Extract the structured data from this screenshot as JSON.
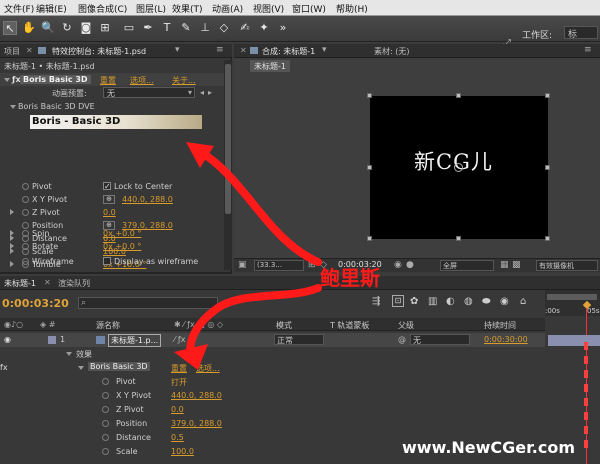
{
  "menu": [
    "文件(F)",
    "编辑(E)",
    "图像合成(C)",
    "图层(L)",
    "效果(T)",
    "动画(A)",
    "视图(V)",
    "窗口(W)",
    "帮助(H)"
  ],
  "toolbar": {
    "workspace_label": "工作区:",
    "workspace_value": "标"
  },
  "left_panel": {
    "tab_project": "项目",
    "tab_effect_controls": "特效控制台: 未标题-1.psd",
    "breadcrumb": "未标题-1 • 未标题-1.psd",
    "effect_name": "Boris Basic 3D",
    "reset": "重置",
    "options": "选项...",
    "about": "关于...",
    "preset_label": "动画预置:",
    "preset_value": "无",
    "group_name": "Boris Basic 3D DVE",
    "logo_text": "Boris - Basic 3D",
    "params": [
      {
        "name": "Pivot",
        "value": "Lock to Center",
        "kind": "checkbox"
      },
      {
        "name": "X Y Pivot",
        "value": "440.0, 288.0",
        "kind": "point"
      },
      {
        "name": "Z Pivot",
        "value": "0.0",
        "kind": "twirl"
      },
      {
        "name": "Position",
        "value": "379.0, 288.0",
        "kind": "point"
      },
      {
        "name": "Distance",
        "value": "0.0",
        "kind": "twirl"
      },
      {
        "name": "Scale",
        "value": "100.0",
        "kind": "plain"
      },
      {
        "name": "Tumble",
        "value": "0x +10.0 °",
        "kind": "plain"
      },
      {
        "name": "Spin",
        "value": "0x +0.0 °",
        "kind": "plain"
      },
      {
        "name": "Rotate",
        "value": "0x +0.0 °",
        "kind": "plain"
      },
      {
        "name": "Wireframe",
        "value": "Display as wireframe",
        "kind": "checkbox"
      }
    ]
  },
  "comp_panel": {
    "tab_comp": "合成: 未标题-1",
    "tab_footage": "素材: (无)",
    "sub_tab": "未标题-1",
    "canvas_text": "新CG儿",
    "zoom_value": "(33.3...",
    "timecode": "0:00:03:20",
    "quality": "全屏",
    "camera": "有效摄像机"
  },
  "timeline": {
    "tab_comp": "未标题-1",
    "tab_render": "渲染队列",
    "timecode": "0:00:03:20",
    "columns": {
      "name": "源名称",
      "mode": "模式",
      "trkmat": "T  轨道蒙板",
      "parent": "父级",
      "duration": "持续时间"
    },
    "layer_index": "1",
    "layer_name": "未标题-1.p...",
    "layer_mode": "正常",
    "layer_parent": "无",
    "layer_duration": "0:00:30:00",
    "effects_label": "效果",
    "effect_name": "Boris Basic 3D",
    "reset": "重置",
    "options": "选项...",
    "ruler_0": ":00s",
    "ruler_1": "05s",
    "rows": [
      {
        "name": "Pivot",
        "value": "打开"
      },
      {
        "name": "X Y Pivot",
        "value": "440.0, 288.0"
      },
      {
        "name": "Z Pivot",
        "value": "0.0"
      },
      {
        "name": "Position",
        "value": "379.0, 288.0"
      },
      {
        "name": "Distance",
        "value": "0.5"
      },
      {
        "name": "Scale",
        "value": "100.0"
      }
    ]
  },
  "annotation": {
    "text": "鲍里斯"
  },
  "watermark": {
    "text": "www.NewCGer.com"
  },
  "colors": {
    "accent_orange": "#d89c2c",
    "annotation_red": "#ff1a1a",
    "timecode_orange": "#e0a339"
  }
}
